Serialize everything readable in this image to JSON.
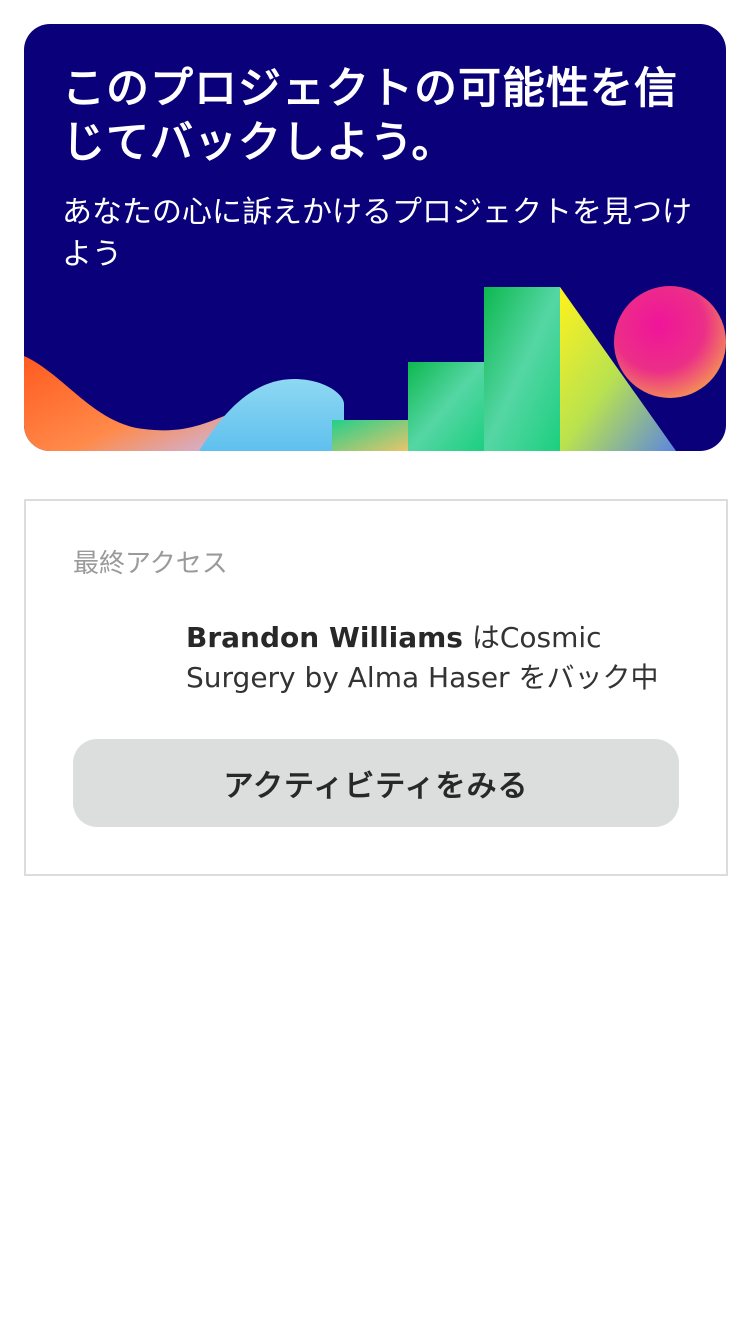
{
  "hero": {
    "title": "このプロジェクトの可能性を信じてバックしよう。",
    "subtitle": "あなたの心に訴えかけるプロジェクトを見つけよう",
    "colors": {
      "background": "#0a017a",
      "orange": "#ff6a1a",
      "blue": "#7fd3f0",
      "green": "#0dbf5a",
      "yellow": "#f5ef2a",
      "pink": "#e8118c"
    }
  },
  "activity": {
    "label": "最終アクセス",
    "user_name": "Brandon Williams",
    "text_after_user": " はCosmic Surgery by Alma Haser をバック中",
    "button_label": "アクティビティをみる"
  }
}
